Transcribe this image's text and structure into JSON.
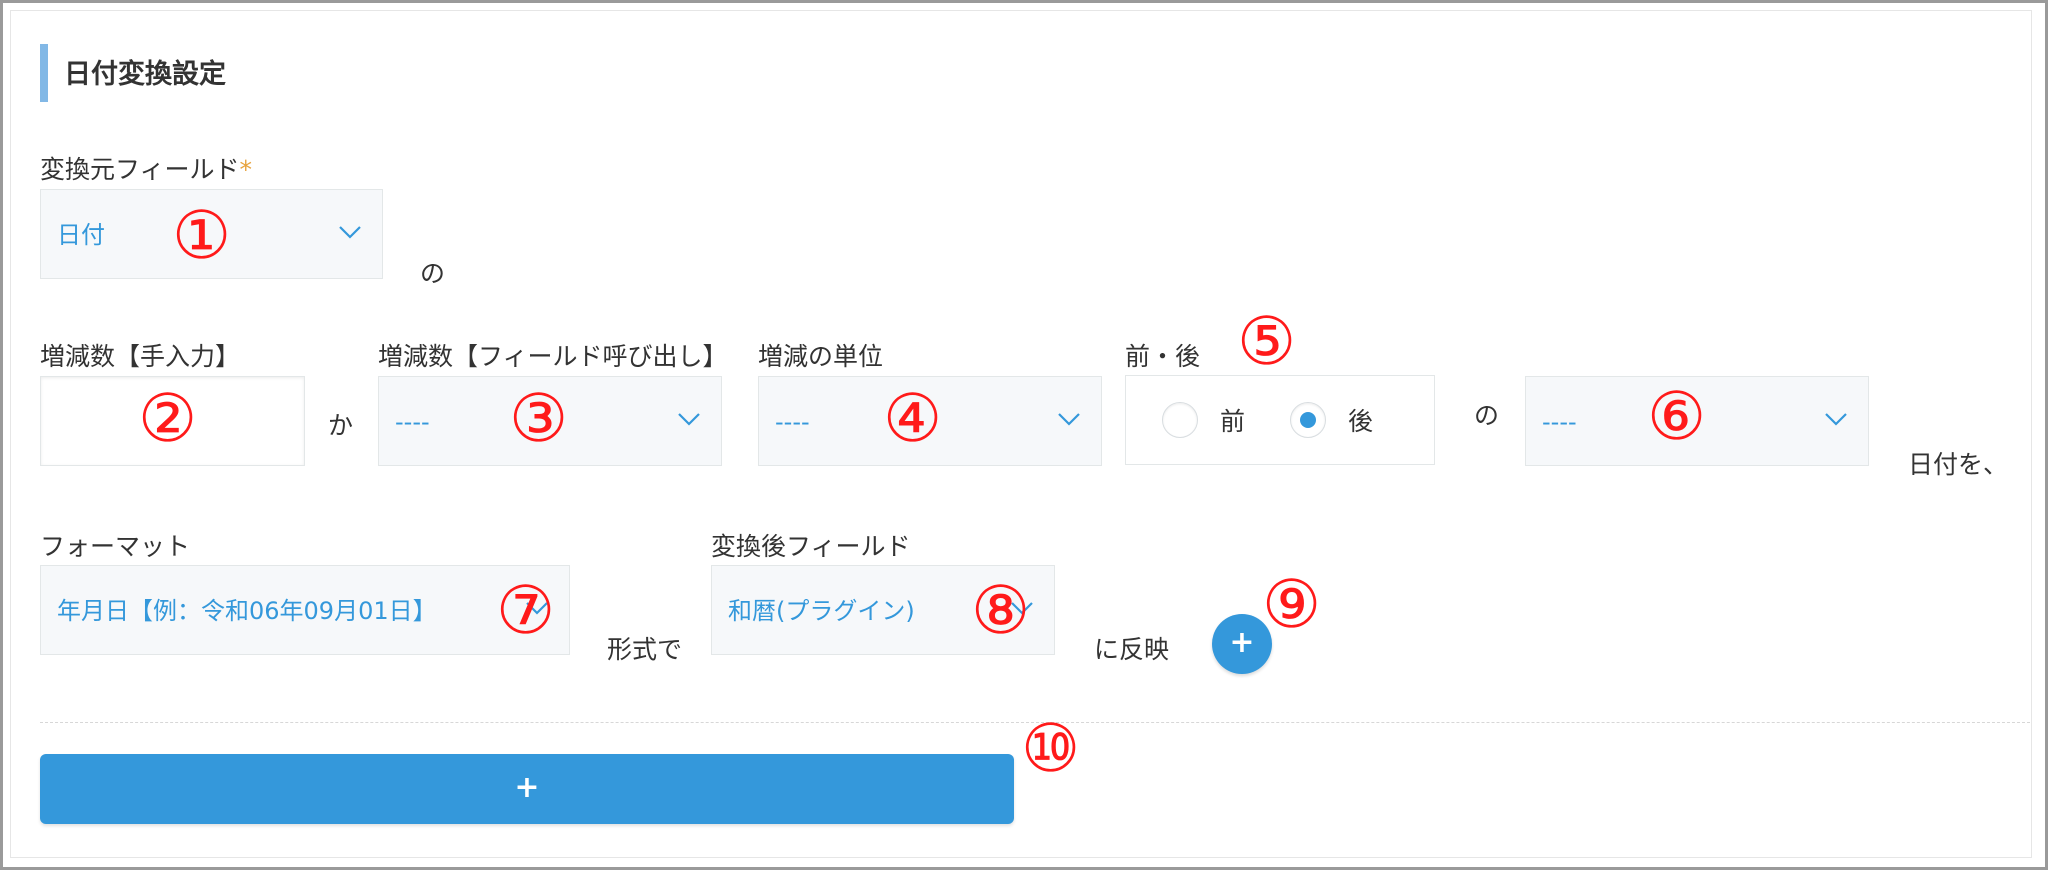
{
  "section": {
    "title": "日付変換設定"
  },
  "source_field": {
    "label": "変換元フィールド",
    "required_mark": "*",
    "value": "日付",
    "suffix": "の"
  },
  "increment_manual": {
    "label": "増減数【手入力】",
    "value": "",
    "suffix": "か"
  },
  "increment_field": {
    "label": "増減数【フィールド呼び出し】",
    "value": "----"
  },
  "unit": {
    "label": "増減の単位",
    "value": "----"
  },
  "direction": {
    "label": "前・後",
    "options": [
      {
        "label": "前",
        "selected": false
      },
      {
        "label": "後",
        "selected": true
      }
    ],
    "suffix": "の"
  },
  "target_part": {
    "value": "----",
    "suffix": "日付を、"
  },
  "format": {
    "label": "フォーマット",
    "value": "年月日【例：令和06年09月01日】",
    "suffix": "形式で"
  },
  "dest_field": {
    "label": "変換後フィールド",
    "value": "和暦(プラグイン)",
    "suffix": "に反映"
  },
  "add_row_button": {
    "label": "+"
  },
  "add_setting_button": {
    "label": "+"
  },
  "callouts": [
    "①",
    "②",
    "③",
    "④",
    "⑤",
    "⑥",
    "⑦",
    "⑧",
    "⑨",
    "⑩"
  ],
  "colors": {
    "accent": "#3498db",
    "title_bar": "#82b8e6",
    "callout": "#ff1a1a",
    "required": "#e7a33e"
  }
}
